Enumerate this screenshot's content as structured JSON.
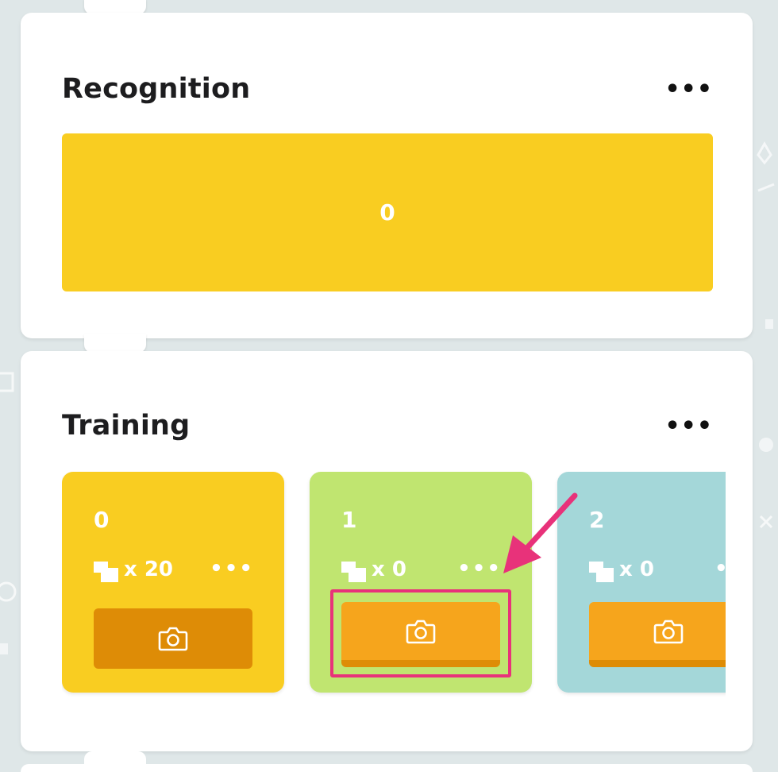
{
  "recognition": {
    "title": "Recognition",
    "more_label": "•••",
    "value": "0",
    "bar_color": "#f9cd21"
  },
  "training": {
    "title": "Training",
    "more_label": "•••",
    "classes": [
      {
        "name": "0",
        "count_label": "x 20",
        "more_label": "•••",
        "color": "#f9cd21",
        "capture_state": "active"
      },
      {
        "name": "1",
        "count_label": "x 0",
        "more_label": "•••",
        "color": "#c0e570",
        "capture_state": "idle"
      },
      {
        "name": "2",
        "count_label": "x 0",
        "more_label": "•",
        "color": "#a4d7d9",
        "capture_state": "idle"
      }
    ]
  },
  "icons": {
    "more": "more-horizontal-icon",
    "samples": "image-stack-icon",
    "camera": "camera-icon",
    "annotation_arrow": "arrow-icon"
  },
  "colors": {
    "background": "#dfe7e8",
    "capture_button": "#f6a51c",
    "capture_button_active": "#de8c06",
    "highlight": "#e8327a"
  }
}
